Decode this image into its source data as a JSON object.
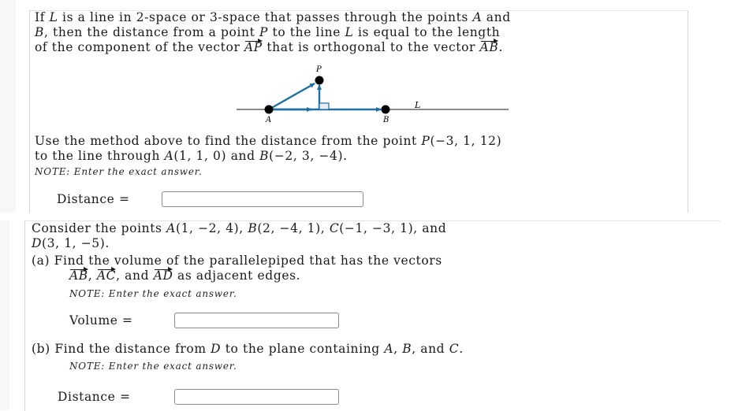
{
  "problem1": {
    "intro_lines": [
      [
        "If ",
        {
          "m": "L"
        },
        " is a line in 2-space or 3-space that passes through the points ",
        {
          "m": "A"
        },
        " and"
      ],
      [
        {
          "m": "B"
        },
        ", then the distance from a point ",
        {
          "m": "P"
        },
        " to the line ",
        {
          "m": "L"
        },
        " is equal to the length"
      ],
      [
        "of the component of the vector ",
        {
          "v": "AP"
        },
        " that is orthogonal to the vector ",
        {
          "v": "AB"
        },
        "."
      ]
    ],
    "diagram": {
      "labels": {
        "P": "P",
        "A": "A",
        "B": "B",
        "L": "L"
      },
      "line_color": "#444444",
      "vector_color": "#1f6fa0",
      "point_color": "#000000"
    },
    "question_lines": [
      [
        "Use the method above to find the distance from the point ",
        {
          "m": "P"
        },
        "(−3, 1, 12)"
      ],
      [
        "to the line through ",
        {
          "m": "A"
        },
        "(1, 1, 0) and ",
        {
          "m": "B"
        },
        "(−2, 3, −4)."
      ]
    ],
    "note": "NOTE: Enter the exact answer.",
    "answer_label": "Distance =",
    "answer_value": ""
  },
  "problem2": {
    "intro_lines": [
      [
        "Consider the points ",
        {
          "m": "A"
        },
        "(1, −2, 4), ",
        {
          "m": "B"
        },
        "(2, −4, 1), ",
        {
          "m": "C"
        },
        "(−1, −3, 1), and"
      ],
      [
        {
          "m": "D"
        },
        "(3, 1, −5)."
      ]
    ],
    "part_a_lines": [
      [
        "(a) Find the volume of the parallelepiped that has the vectors"
      ],
      [
        {
          "v": "AB"
        },
        ", ",
        {
          "v": "AC"
        },
        ", and ",
        {
          "v": "AD"
        },
        " as adjacent edges."
      ]
    ],
    "part_a_note": "NOTE: Enter the exact answer.",
    "part_a_label": "Volume =",
    "part_a_value": "",
    "part_b_lines": [
      [
        "(b) Find the distance from ",
        {
          "m": "D"
        },
        " to the plane containing ",
        {
          "m": "A"
        },
        ", ",
        {
          "m": "B"
        },
        ", and ",
        {
          "m": "C"
        },
        "."
      ]
    ],
    "part_b_note": "NOTE: Enter the exact answer.",
    "part_b_label": "Distance =",
    "part_b_value": ""
  }
}
